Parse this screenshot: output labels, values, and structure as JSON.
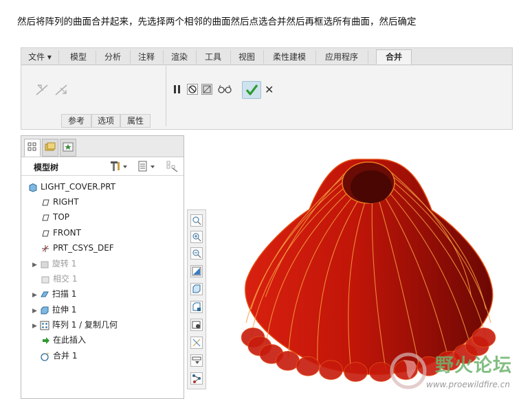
{
  "instruction": "然后将阵列的曲面合并起来，先选择两个相邻的曲面然后点选合并然后再框选所有曲面，然后确定",
  "ribbon": {
    "tabs": [
      {
        "label": "文件 ▾"
      },
      {
        "label": "模型"
      },
      {
        "label": "分析"
      },
      {
        "label": "注释"
      },
      {
        "label": "渲染"
      },
      {
        "label": "工具"
      },
      {
        "label": "视图"
      },
      {
        "label": "柔性建模"
      },
      {
        "label": "应用程序"
      },
      {
        "label": "合并"
      }
    ],
    "active_tab": "合并",
    "subtabs": [
      {
        "label": "参考"
      },
      {
        "label": "选项"
      },
      {
        "label": "属性"
      }
    ],
    "confirm_color": "#2e9b2e",
    "cancel_symbol": "✕"
  },
  "model_tree": {
    "title": "模型树",
    "items": [
      {
        "label": "LIGHT_COVER.PRT",
        "icon": "part-icon"
      },
      {
        "label": "RIGHT",
        "icon": "datum-plane-icon"
      },
      {
        "label": "TOP",
        "icon": "datum-plane-icon"
      },
      {
        "label": "FRONT",
        "icon": "datum-plane-icon"
      },
      {
        "label": "PRT_CSYS_DEF",
        "icon": "csys-icon"
      },
      {
        "label": "旋转 1",
        "icon": "revolve-icon"
      },
      {
        "label": "相交 1",
        "icon": "intersect-icon"
      },
      {
        "label": "扫描 1",
        "icon": "sweep-icon"
      },
      {
        "label": "拉伸 1",
        "icon": "extrude-icon"
      },
      {
        "label": "阵列 1 / 复制几何",
        "icon": "pattern-icon"
      },
      {
        "label": "在此插入",
        "icon": "insert-here-icon"
      },
      {
        "label": "合并 1",
        "icon": "merge-icon"
      }
    ]
  },
  "model_color": "#b01005",
  "watermark": {
    "title": "野火论坛",
    "url": "www.proewildfire.cn"
  }
}
